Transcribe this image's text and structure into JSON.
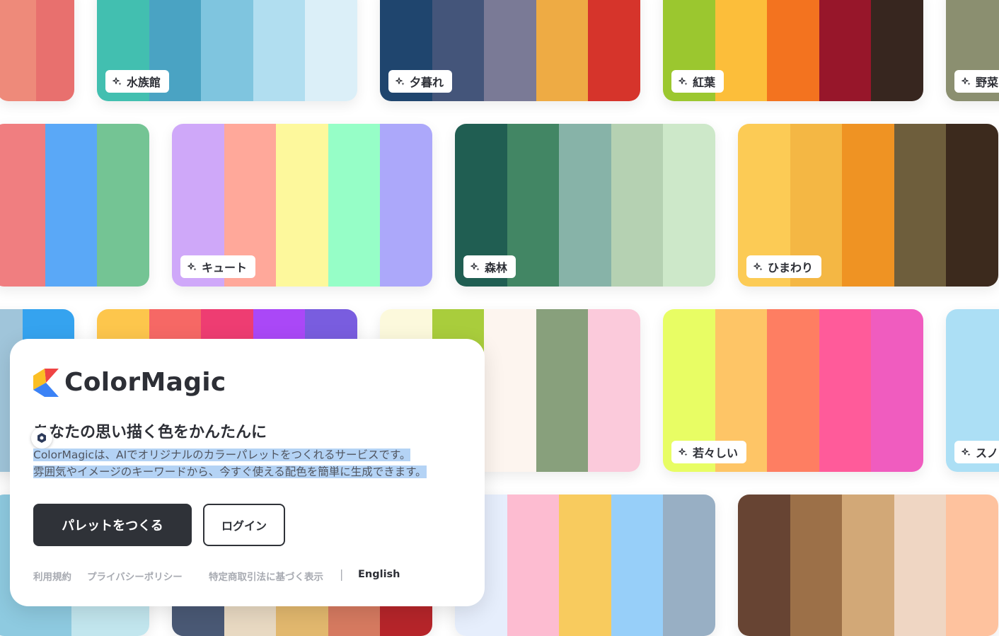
{
  "palettes": [
    {
      "name": "",
      "colors": [
        "#ee8a7a",
        "#e8706e"
      ]
    },
    {
      "name": "水族館",
      "colors": [
        "#42bfb0",
        "#4aa3c3",
        "#7fc5df",
        "#b1def0",
        "#dbeff8"
      ]
    },
    {
      "name": "夕暮れ",
      "colors": [
        "#1f456e",
        "#44557a",
        "#7a7a96",
        "#eeab44",
        "#d6342b"
      ]
    },
    {
      "name": "紅葉",
      "colors": [
        "#9bc72f",
        "#fcbe3a",
        "#f3731f",
        "#97162a",
        "#37261f"
      ]
    },
    {
      "name": "野菜",
      "colors": [
        "#8b8f70"
      ]
    },
    {
      "name": "",
      "colors": [
        "#f07e80",
        "#5aa8f7",
        "#74c494"
      ]
    },
    {
      "name": "キュート",
      "colors": [
        "#cfa8f9",
        "#ffa89a",
        "#fdf89c",
        "#96fec7",
        "#aca8fa"
      ]
    },
    {
      "name": "森林",
      "colors": [
        "#205e52",
        "#428664",
        "#87b3a8",
        "#b5d1b2",
        "#cde8c9"
      ]
    },
    {
      "name": "ひまわり",
      "colors": [
        "#fccb55",
        "#f4b744",
        "#ef9323",
        "#6e5e3c",
        "#3c2a1d"
      ]
    },
    {
      "name": "",
      "colors": [
        "#a0c5da",
        "#35a3ef"
      ]
    },
    {
      "name": "",
      "colors": [
        "#fdc64c",
        "#f66865",
        "#ee3d72",
        "#aa48f7",
        "#795ddf"
      ]
    },
    {
      "name": "",
      "colors": [
        "#fcf9dc",
        "#a9cd3c",
        "#fdf5ef",
        "#88a07c",
        "#fbcadb"
      ]
    },
    {
      "name": "若々しい",
      "colors": [
        "#e8fd64",
        "#fec566",
        "#fe7e62",
        "#ff5b9a",
        "#f05cbf"
      ]
    },
    {
      "name": "スノ",
      "colors": [
        "#acdff5"
      ]
    },
    {
      "name": "",
      "colors": [
        "#8ecae0",
        "#c2e6ee"
      ]
    },
    {
      "name": "",
      "colors": [
        "#4a5975",
        "#e8d9c2",
        "#e2b86e",
        "#d67a60",
        "#b6252a"
      ]
    },
    {
      "name": "",
      "colors": [
        "#e6eefc",
        "#fdbcd1",
        "#f8cb5e",
        "#97cff9",
        "#98afc4"
      ]
    },
    {
      "name": "",
      "colors": [
        "#674433",
        "#9c7048",
        "#d2a877",
        "#efd6c3",
        "#fec29e"
      ]
    }
  ],
  "brand": {
    "name": "ColorMagic"
  },
  "intro": {
    "headline": "あなたの思い描く色をかんたんに",
    "description_line1": "ColorMagicは、AIでオリジナルのカラーパレットをつくれるサービスです。",
    "description_line2": "雰囲気やイメージのキーワードから、今すぐ使える配色を簡単に生成できます。"
  },
  "actions": {
    "create_label": "パレットをつくる",
    "login_label": "ログイン"
  },
  "footer": {
    "terms": "利用規約",
    "privacy": "プライバシーポリシー",
    "commerce": "特定商取引法に基づく表示",
    "separator": "|",
    "language": "English"
  }
}
